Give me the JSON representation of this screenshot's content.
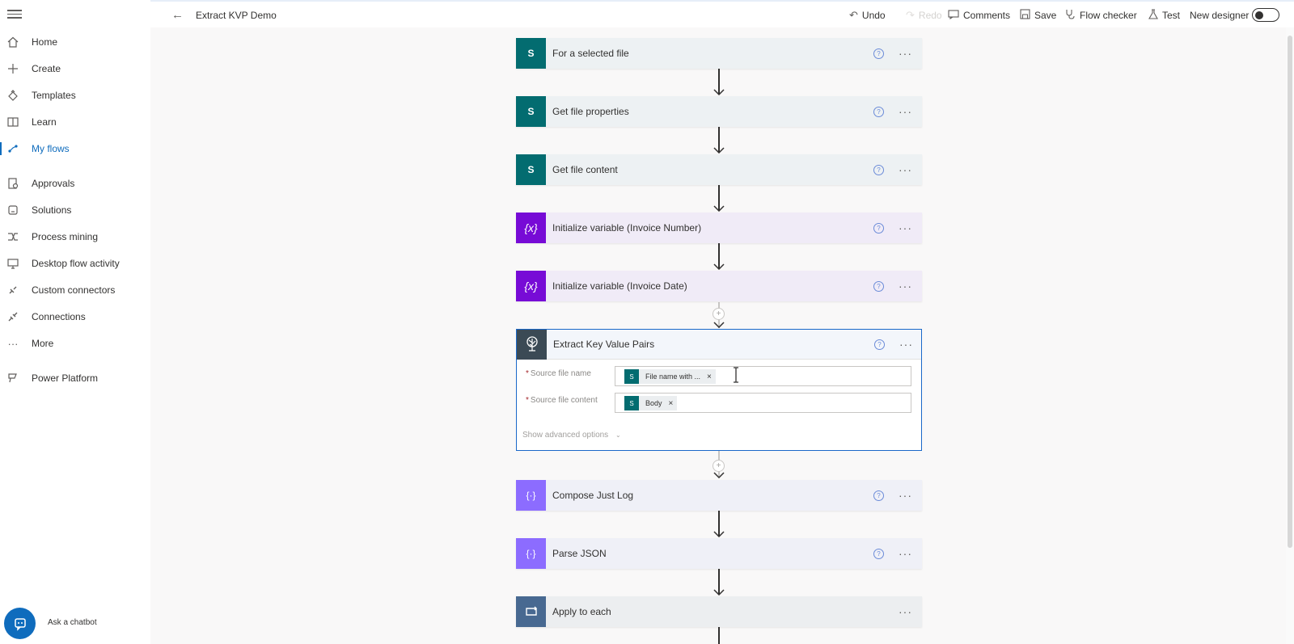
{
  "topbar": {
    "flow_title": "Extract KVP Demo",
    "undo": "Undo",
    "redo": "Redo",
    "comments": "Comments",
    "save": "Save",
    "flow_checker": "Flow checker",
    "test": "Test",
    "new_designer": "New designer"
  },
  "sidebar": {
    "items": [
      {
        "label": "Home",
        "icon": "home-icon"
      },
      {
        "label": "Create",
        "icon": "plus-icon"
      },
      {
        "label": "Templates",
        "icon": "templates-icon"
      },
      {
        "label": "Learn",
        "icon": "book-icon"
      },
      {
        "label": "My flows",
        "icon": "flows-icon",
        "active": true
      },
      {
        "label": "Approvals",
        "icon": "approvals-icon"
      },
      {
        "label": "Solutions",
        "icon": "solutions-icon"
      },
      {
        "label": "Process mining",
        "icon": "process-mining-icon"
      },
      {
        "label": "Desktop flow activity",
        "icon": "desktop-flow-icon"
      },
      {
        "label": "Custom connectors",
        "icon": "custom-connectors-icon"
      },
      {
        "label": "Connections",
        "icon": "connections-icon"
      },
      {
        "label": "More",
        "icon": "more-icon"
      },
      {
        "label": "Power Platform",
        "icon": "power-platform-icon"
      }
    ],
    "chatbot_label": "Ask a chatbot"
  },
  "flow": {
    "steps": [
      {
        "title": "For a selected file",
        "icon": "sharepoint-icon",
        "kind": "sharepoint"
      },
      {
        "title": "Get file properties",
        "icon": "sharepoint-icon",
        "kind": "sharepoint"
      },
      {
        "title": "Get file content",
        "icon": "sharepoint-icon",
        "kind": "sharepoint"
      },
      {
        "title": "Initialize variable (Invoice Number)",
        "icon": "variable-icon",
        "kind": "variable"
      },
      {
        "title": "Initialize variable (Invoice Date)",
        "icon": "variable-icon",
        "kind": "variable"
      },
      {
        "title": "Extract Key Value Pairs",
        "icon": "tree-icon",
        "kind": "custom"
      },
      {
        "title": "Compose Just Log",
        "icon": "compose-icon",
        "kind": "compose"
      },
      {
        "title": "Parse JSON",
        "icon": "compose-icon",
        "kind": "compose"
      },
      {
        "title": "Apply to each",
        "icon": "loop-icon",
        "kind": "loop"
      }
    ],
    "expanded": {
      "fields": [
        {
          "label": "Source file name",
          "token": "File name with ..."
        },
        {
          "label": "Source file content",
          "token": "Body"
        }
      ],
      "advanced": "Show advanced options"
    }
  },
  "colors": {
    "sharepoint": "#036c70",
    "variable": "#770bd6",
    "compose": "#8c6cff",
    "loop": "#486991",
    "accent": "#0f6cbd"
  }
}
